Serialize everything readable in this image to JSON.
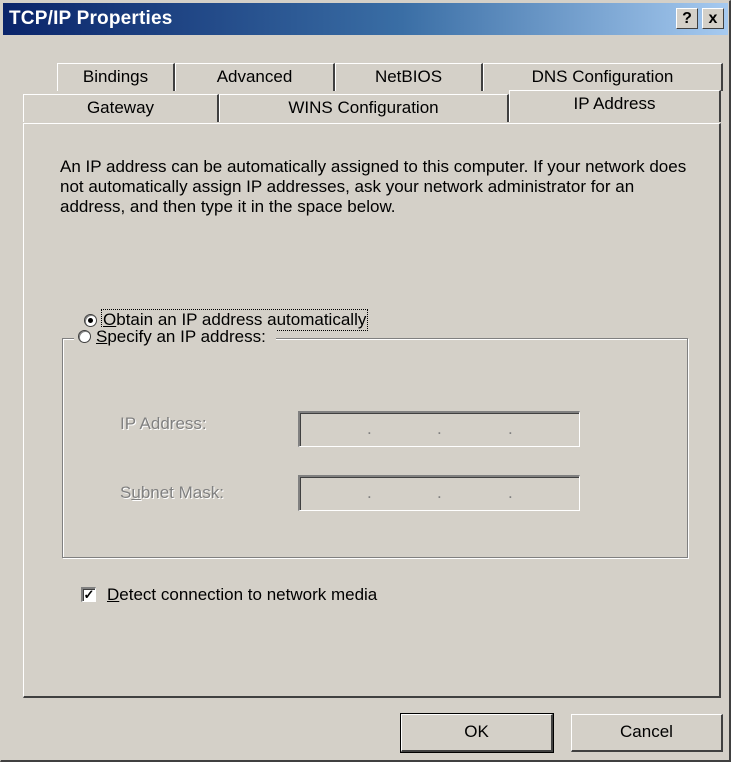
{
  "window": {
    "title": "TCP/IP Properties",
    "help_label": "?",
    "close_label": "x"
  },
  "tabs": {
    "row1": [
      "Bindings",
      "Advanced",
      "NetBIOS",
      "DNS Configuration"
    ],
    "row2": [
      "Gateway",
      "WINS Configuration",
      "IP Address"
    ],
    "active": "IP Address"
  },
  "panel": {
    "description": "An IP address can be automatically assigned to this computer.  If your network does not automatically assign IP addresses, ask your network administrator for an address, and then type it in the space below.",
    "obtain_auto": {
      "accel": "O",
      "rest": "btain an IP address automatically",
      "selected": true
    },
    "specify": {
      "accel": "S",
      "rest": "pecify an IP address:",
      "selected": false
    },
    "ip_address_label": "IP Address:",
    "subnet_label_pre": "S",
    "subnet_label_accel": "u",
    "subnet_label_rest": "bnet Mask:",
    "ip_address_value": [
      "",
      "",
      "",
      ""
    ],
    "subnet_value": [
      "",
      "",
      "",
      ""
    ],
    "detect": {
      "accel": "D",
      "rest": "etect connection to network media",
      "checked": true
    }
  },
  "buttons": {
    "ok": "OK",
    "cancel": "Cancel"
  },
  "colors": {
    "face": "#d4d0c8",
    "title_start": "#0a246a",
    "title_end": "#a6caf0"
  }
}
